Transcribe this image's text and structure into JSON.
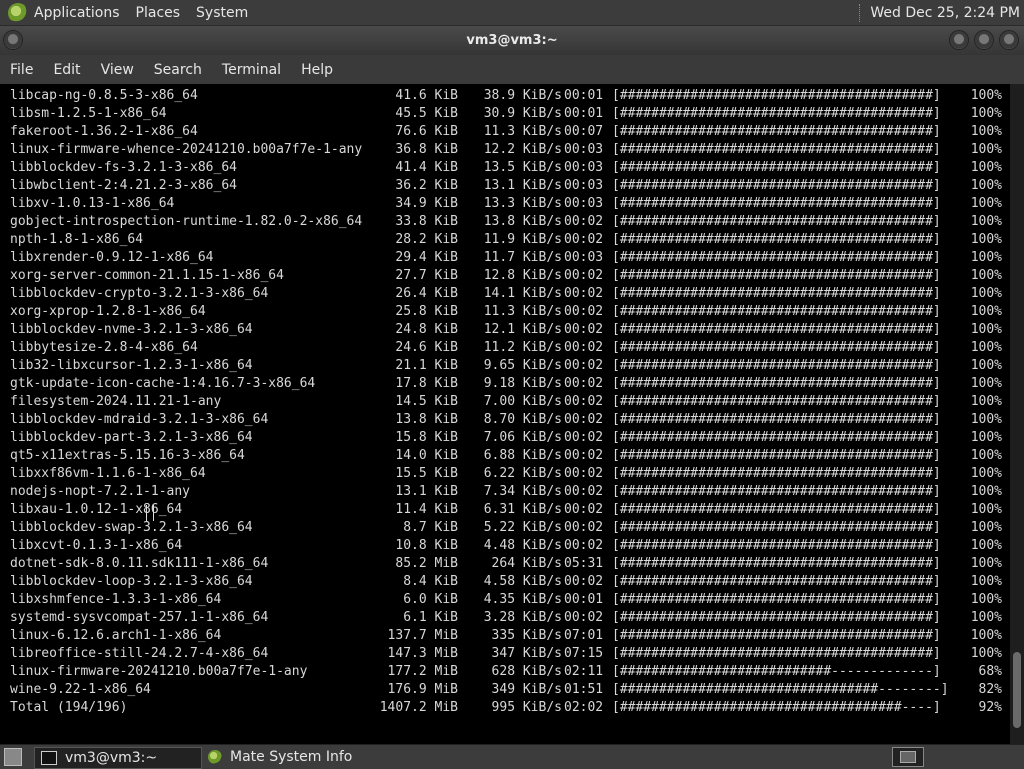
{
  "top_panel": {
    "menus": [
      "Applications",
      "Places",
      "System"
    ],
    "clock": "Wed Dec 25,  2:24 PM"
  },
  "window": {
    "title": "vm3@vm3:~",
    "menus": [
      "File",
      "Edit",
      "View",
      "Search",
      "Terminal",
      "Help"
    ]
  },
  "terminal": {
    "rows": [
      {
        "name": "libcap-ng-0.8.5-3-x86_64",
        "size": "41.6 KiB",
        "rate": "38.9 KiB/s",
        "time": "00:01",
        "bar": "[########################################]",
        "pct": "100%"
      },
      {
        "name": "libsm-1.2.5-1-x86_64",
        "size": "45.5 KiB",
        "rate": "30.9 KiB/s",
        "time": "00:01",
        "bar": "[########################################]",
        "pct": "100%"
      },
      {
        "name": "fakeroot-1.36.2-1-x86_64",
        "size": "76.6 KiB",
        "rate": "11.3 KiB/s",
        "time": "00:07",
        "bar": "[########################################]",
        "pct": "100%"
      },
      {
        "name": "linux-firmware-whence-20241210.b00a7f7e-1-any",
        "size": "36.8 KiB",
        "rate": "12.2 KiB/s",
        "time": "00:03",
        "bar": "[########################################]",
        "pct": "100%"
      },
      {
        "name": "libblockdev-fs-3.2.1-3-x86_64",
        "size": "41.4 KiB",
        "rate": "13.5 KiB/s",
        "time": "00:03",
        "bar": "[########################################]",
        "pct": "100%"
      },
      {
        "name": "libwbclient-2:4.21.2-3-x86_64",
        "size": "36.2 KiB",
        "rate": "13.1 KiB/s",
        "time": "00:03",
        "bar": "[########################################]",
        "pct": "100%"
      },
      {
        "name": "libxv-1.0.13-1-x86_64",
        "size": "34.9 KiB",
        "rate": "13.3 KiB/s",
        "time": "00:03",
        "bar": "[########################################]",
        "pct": "100%"
      },
      {
        "name": "gobject-introspection-runtime-1.82.0-2-x86_64",
        "size": "33.8 KiB",
        "rate": "13.8 KiB/s",
        "time": "00:02",
        "bar": "[########################################]",
        "pct": "100%"
      },
      {
        "name": "npth-1.8-1-x86_64",
        "size": "28.2 KiB",
        "rate": "11.9 KiB/s",
        "time": "00:02",
        "bar": "[########################################]",
        "pct": "100%"
      },
      {
        "name": "libxrender-0.9.12-1-x86_64",
        "size": "29.4 KiB",
        "rate": "11.7 KiB/s",
        "time": "00:03",
        "bar": "[########################################]",
        "pct": "100%"
      },
      {
        "name": "xorg-server-common-21.1.15-1-x86_64",
        "size": "27.7 KiB",
        "rate": "12.8 KiB/s",
        "time": "00:02",
        "bar": "[########################################]",
        "pct": "100%"
      },
      {
        "name": "libblockdev-crypto-3.2.1-3-x86_64",
        "size": "26.4 KiB",
        "rate": "14.1 KiB/s",
        "time": "00:02",
        "bar": "[########################################]",
        "pct": "100%"
      },
      {
        "name": "xorg-xprop-1.2.8-1-x86_64",
        "size": "25.8 KiB",
        "rate": "11.3 KiB/s",
        "time": "00:02",
        "bar": "[########################################]",
        "pct": "100%"
      },
      {
        "name": "libblockdev-nvme-3.2.1-3-x86_64",
        "size": "24.8 KiB",
        "rate": "12.1 KiB/s",
        "time": "00:02",
        "bar": "[########################################]",
        "pct": "100%"
      },
      {
        "name": "libbytesize-2.8-4-x86_64",
        "size": "24.6 KiB",
        "rate": "11.2 KiB/s",
        "time": "00:02",
        "bar": "[########################################]",
        "pct": "100%"
      },
      {
        "name": "lib32-libxcursor-1.2.3-1-x86_64",
        "size": "21.1 KiB",
        "rate": "9.65 KiB/s",
        "time": "00:02",
        "bar": "[########################################]",
        "pct": "100%"
      },
      {
        "name": "gtk-update-icon-cache-1:4.16.7-3-x86_64",
        "size": "17.8 KiB",
        "rate": "9.18 KiB/s",
        "time": "00:02",
        "bar": "[########################################]",
        "pct": "100%"
      },
      {
        "name": "filesystem-2024.11.21-1-any",
        "size": "14.5 KiB",
        "rate": "7.00 KiB/s",
        "time": "00:02",
        "bar": "[########################################]",
        "pct": "100%"
      },
      {
        "name": "libblockdev-mdraid-3.2.1-3-x86_64",
        "size": "13.8 KiB",
        "rate": "8.70 KiB/s",
        "time": "00:02",
        "bar": "[########################################]",
        "pct": "100%"
      },
      {
        "name": "libblockdev-part-3.2.1-3-x86_64",
        "size": "15.8 KiB",
        "rate": "7.06 KiB/s",
        "time": "00:02",
        "bar": "[########################################]",
        "pct": "100%"
      },
      {
        "name": "qt5-x11extras-5.15.16-3-x86_64",
        "size": "14.0 KiB",
        "rate": "6.88 KiB/s",
        "time": "00:02",
        "bar": "[########################################]",
        "pct": "100%"
      },
      {
        "name": "libxxf86vm-1.1.6-1-x86_64",
        "size": "15.5 KiB",
        "rate": "6.22 KiB/s",
        "time": "00:02",
        "bar": "[########################################]",
        "pct": "100%"
      },
      {
        "name": "nodejs-nopt-7.2.1-1-any",
        "size": "13.1 KiB",
        "rate": "7.34 KiB/s",
        "time": "00:02",
        "bar": "[########################################]",
        "pct": "100%"
      },
      {
        "name": "libxau-1.0.12-1-x86_64",
        "size": "11.4 KiB",
        "rate": "6.31 KiB/s",
        "time": "00:02",
        "bar": "[########################################]",
        "pct": "100%"
      },
      {
        "name": "libblockdev-swap-3.2.1-3-x86_64",
        "size": "8.7 KiB",
        "rate": "5.22 KiB/s",
        "time": "00:02",
        "bar": "[########################################]",
        "pct": "100%"
      },
      {
        "name": "libxcvt-0.1.3-1-x86_64",
        "size": "10.8 KiB",
        "rate": "4.48 KiB/s",
        "time": "00:02",
        "bar": "[########################################]",
        "pct": "100%"
      },
      {
        "name": "dotnet-sdk-8.0.11.sdk111-1-x86_64",
        "size": "85.2 MiB",
        "rate": "264 KiB/s",
        "time": "05:31",
        "bar": "[########################################]",
        "pct": "100%"
      },
      {
        "name": "libblockdev-loop-3.2.1-3-x86_64",
        "size": "8.4 KiB",
        "rate": "4.58 KiB/s",
        "time": "00:02",
        "bar": "[########################################]",
        "pct": "100%"
      },
      {
        "name": "libxshmfence-1.3.3-1-x86_64",
        "size": "6.0 KiB",
        "rate": "4.35 KiB/s",
        "time": "00:01",
        "bar": "[########################################]",
        "pct": "100%"
      },
      {
        "name": "systemd-sysvcompat-257.1-1-x86_64",
        "size": "6.1 KiB",
        "rate": "3.28 KiB/s",
        "time": "00:02",
        "bar": "[########################################]",
        "pct": "100%"
      },
      {
        "name": "linux-6.12.6.arch1-1-x86_64",
        "size": "137.7 MiB",
        "rate": "335 KiB/s",
        "time": "07:01",
        "bar": "[########################################]",
        "pct": "100%"
      },
      {
        "name": "libreoffice-still-24.2.7-4-x86_64",
        "size": "147.3 MiB",
        "rate": "347 KiB/s",
        "time": "07:15",
        "bar": "[########################################]",
        "pct": "100%"
      },
      {
        "name": "linux-firmware-20241210.b00a7f7e-1-any",
        "size": "177.2 MiB",
        "rate": "628 KiB/s",
        "time": "02:11",
        "bar": "[###########################-------------]",
        "pct": "68%"
      },
      {
        "name": "wine-9.22-1-x86_64",
        "size": "176.9 MiB",
        "rate": "349 KiB/s",
        "time": "01:51",
        "bar": "[#################################--------]",
        "pct": "82%"
      },
      {
        "name": "Total (194/196)",
        "size": "1407.2 MiB",
        "rate": "995 KiB/s",
        "time": "02:02",
        "bar": "[####################################----]",
        "pct": "92%"
      }
    ]
  },
  "taskbar": {
    "tasks": [
      "vm3@vm3:~",
      "Mate System Info"
    ]
  },
  "colors": {
    "panel": "#3c3c3c",
    "terminal_bg": "#000000",
    "terminal_fg": "#d8d8d8"
  }
}
